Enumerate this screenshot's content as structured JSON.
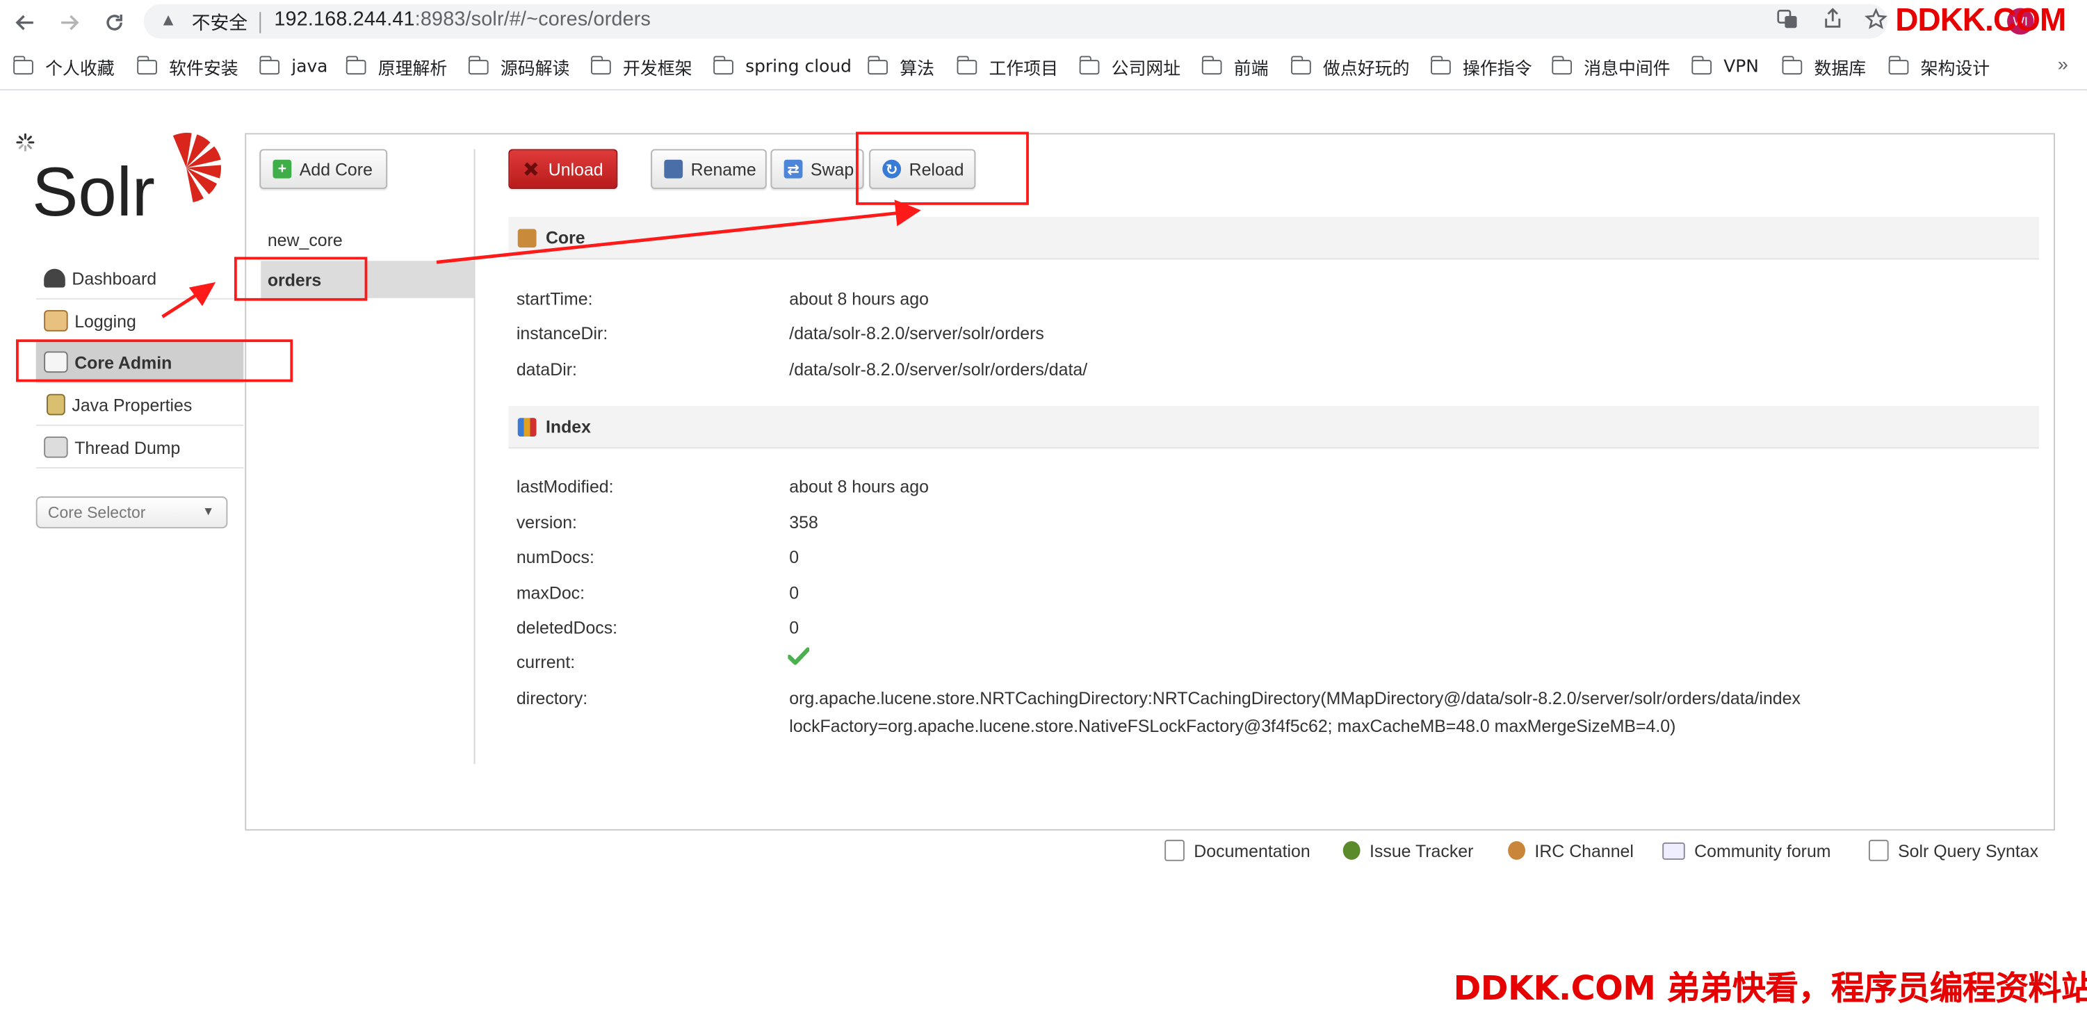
{
  "browser": {
    "security_label": "不安全",
    "url_host": "192.168.244.41",
    "url_rest": ":8983/solr/#/~cores/orders",
    "watermark_top": "DDKK.COM",
    "avatar_text": "WI",
    "bookmarks": [
      "个人收藏",
      "软件安装",
      "java",
      "原理解析",
      "源码解读",
      "开发框架",
      "spring cloud",
      "算法",
      "工作项目",
      "公司网址",
      "前端",
      "做点好玩的",
      "操作指令",
      "消息中间件",
      "VPN",
      "数据库",
      "架构设计"
    ],
    "bookmarks_more": "»"
  },
  "solr": {
    "logo_text": "Solr",
    "nav": [
      {
        "label": "Dashboard",
        "icon": "dashboard-icon"
      },
      {
        "label": "Logging",
        "icon": "logging-icon"
      },
      {
        "label": "Core Admin",
        "icon": "core-admin-icon"
      },
      {
        "label": "Java Properties",
        "icon": "java-properties-icon"
      },
      {
        "label": "Thread Dump",
        "icon": "thread-dump-icon"
      }
    ],
    "core_selector": "Core Selector"
  },
  "core_admin": {
    "add_core": "Add Core",
    "cores": [
      "new_core",
      "orders"
    ],
    "selected_core": "orders",
    "actions": {
      "unload": "Unload",
      "rename": "Rename",
      "swap": "Swap",
      "reload": "Reload"
    },
    "core_section": {
      "title": "Core",
      "fields": [
        {
          "key": "startTime:",
          "value": "about 8 hours ago"
        },
        {
          "key": "instanceDir:",
          "value": "/data/solr-8.2.0/server/solr/orders"
        },
        {
          "key": "dataDir:",
          "value": "/data/solr-8.2.0/server/solr/orders/data/"
        }
      ]
    },
    "index_section": {
      "title": "Index",
      "fields": [
        {
          "key": "lastModified:",
          "value": "about 8 hours ago"
        },
        {
          "key": "version:",
          "value": "358"
        },
        {
          "key": "numDocs:",
          "value": "0"
        },
        {
          "key": "maxDoc:",
          "value": "0"
        },
        {
          "key": "deletedDocs:",
          "value": "0"
        },
        {
          "key": "current:",
          "value": ""
        },
        {
          "key": "directory:",
          "value": "org.apache.lucene.store.NRTCachingDirectory:NRTCachingDirectory(MMapDirectory@/data/solr-8.2.0/server/solr/orders/data/index",
          "value2": "lockFactory=org.apache.lucene.store.NativeFSLockFactory@3f4f5c62; maxCacheMB=48.0 maxMergeSizeMB=4.0)"
        }
      ]
    }
  },
  "footer": [
    "Documentation",
    "Issue Tracker",
    "IRC Channel",
    "Community forum",
    "Solr Query Syntax"
  ],
  "watermark_bottom": "DDKK.COM 弟弟快看，程序员编程资料站",
  "colors": {
    "accent_red": "#d9261c",
    "annotation_red": "#ff1a1a",
    "check_green": "#4caf50"
  }
}
